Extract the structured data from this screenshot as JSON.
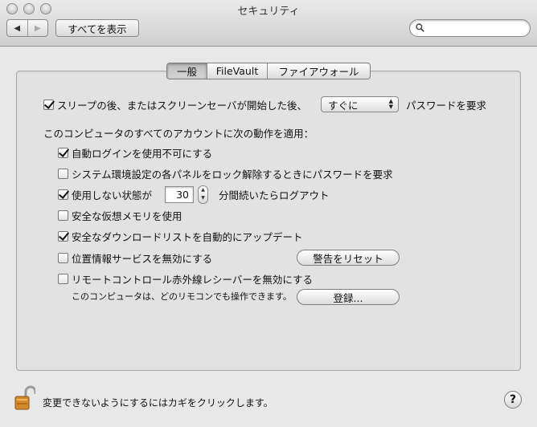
{
  "window": {
    "title": "セキュリティ"
  },
  "toolbar": {
    "back_glyph": "◀",
    "forward_glyph": "▶",
    "show_all_label": "すべてを表示",
    "search_placeholder": "",
    "search_value": ""
  },
  "tabs": [
    {
      "label": "一般",
      "active": true
    },
    {
      "label": "FileVault",
      "active": false
    },
    {
      "label": "ファイアウォール",
      "active": false
    }
  ],
  "sleep_row": {
    "label": "スリープの後、またはスクリーンセーバが開始した後、",
    "popup_value": "すぐに",
    "suffix": "パスワードを要求",
    "checked": true
  },
  "section_heading": "このコンピュータのすべてのアカウントに次の動作を適用：",
  "options": [
    {
      "label": "自動ログインを使用不可にする",
      "checked": true
    },
    {
      "label": "システム環境設定の各パネルをロック解除するときにパスワードを要求",
      "checked": false
    },
    {
      "label": "使用しない状態が",
      "checked": true,
      "minutes": "30",
      "suffix": "分間続いたらログアウト"
    },
    {
      "label": "安全な仮想メモリを使用",
      "checked": false
    },
    {
      "label": "安全なダウンロードリストを自動的にアップデート",
      "checked": true
    },
    {
      "label": "位置情報サービスを無効にする",
      "checked": false,
      "button": "警告をリセット"
    },
    {
      "label": "リモートコントロール赤外線レシーバーを無効にする",
      "checked": false,
      "note": "このコンピュータは、どのリモコンでも操作できます。",
      "button": "登録..."
    }
  ],
  "footer": {
    "lock_text": "変更できないようにするにはカギをクリックします。",
    "help_glyph": "?"
  }
}
